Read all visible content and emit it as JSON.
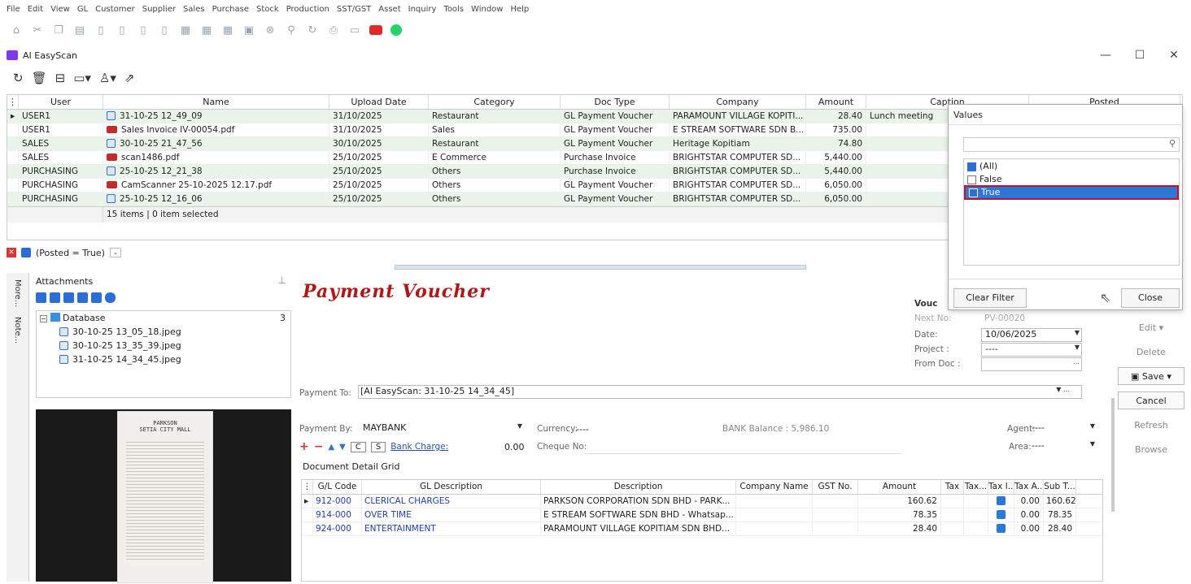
{
  "menu": [
    "File",
    "Edit",
    "View",
    "GL",
    "Customer",
    "Supplier",
    "Sales",
    "Purchase",
    "Stock",
    "Production",
    "SST/GST",
    "Asset",
    "Inquiry",
    "Tools",
    "Window",
    "Help"
  ],
  "window": {
    "title": "AI EasyScan"
  },
  "grid": {
    "columns": [
      "User",
      "Name",
      "Upload Date",
      "Category",
      "Doc Type",
      "Company",
      "Amount",
      "Caption",
      "Posted"
    ],
    "rows": [
      {
        "user": "USER1",
        "name": "31-10-25 12_49_09",
        "date": "31/10/2025",
        "category": "Restaurant",
        "doctype": "GL Payment Voucher",
        "company": "PARAMOUNT VILLAGE KOPITI...",
        "amount": "28.40",
        "caption": "Lunch meeting",
        "icon": "image"
      },
      {
        "user": "USER1",
        "name": "Sales Invoice IV-00054.pdf",
        "date": "31/10/2025",
        "category": "Sales",
        "doctype": "GL Payment Voucher",
        "company": "E STREAM SOFTWARE SDN B...",
        "amount": "735.00",
        "caption": "",
        "icon": "pdf"
      },
      {
        "user": "SALES",
        "name": "30-10-25 21_47_56",
        "date": "30/10/2025",
        "category": "Restaurant",
        "doctype": "GL Payment Voucher",
        "company": "Heritage Kopitiam",
        "amount": "74.80",
        "caption": "",
        "icon": "image"
      },
      {
        "user": "SALES",
        "name": "scan1486.pdf",
        "date": "25/10/2025",
        "category": "E Commerce",
        "doctype": "Purchase Invoice",
        "company": "BRIGHTSTAR COMPUTER SD...",
        "amount": "5,440.00",
        "caption": "",
        "icon": "pdf"
      },
      {
        "user": "PURCHASING",
        "name": "25-10-25 12_21_38",
        "date": "25/10/2025",
        "category": "Others",
        "doctype": "Purchase Invoice",
        "company": "BRIGHTSTAR COMPUTER SD...",
        "amount": "5,440.00",
        "caption": "",
        "icon": "image"
      },
      {
        "user": "PURCHASING",
        "name": "CamScanner 25-10-2025 12.17.pdf",
        "date": "25/10/2025",
        "category": "Others",
        "doctype": "GL Payment Voucher",
        "company": "BRIGHTSTAR COMPUTER SD...",
        "amount": "6,050.00",
        "caption": "",
        "icon": "pdf"
      },
      {
        "user": "PURCHASING",
        "name": "25-10-25 12_16_06",
        "date": "25/10/2025",
        "category": "Others",
        "doctype": "GL Payment Voucher",
        "company": "BRIGHTSTAR COMPUTER SD...",
        "amount": "6,050.00",
        "caption": "",
        "icon": "image"
      }
    ],
    "footer": "15 items | 0 item selected"
  },
  "filter": {
    "text": "(Posted = True)"
  },
  "sidetabs": {
    "more": "More...",
    "note": "Note..."
  },
  "attachments": {
    "title": "Attachments",
    "root": "Database",
    "count": "3",
    "files": [
      "30-10-25 13_05_18.jpeg",
      "30-10-25 13_35_39.jpeg",
      "31-10-25 14_34_45.jpeg"
    ],
    "receipt": {
      "store": "PARKSON",
      "mall": "SETIA CITY MALL"
    }
  },
  "voucher": {
    "title": "Payment Voucher",
    "voucher_label": "Vouc",
    "next_no_label": "Next No:",
    "next_no": "PV-00020",
    "date_label": "Date:",
    "date": "10/06/2025",
    "project_label": "Project :",
    "project": "----",
    "fromdoc_label": "From Doc :",
    "payto_label": "Payment To:",
    "payto": "[AI EasyScan: 31-10-25 14_34_45]",
    "payby_label": "Payment By:",
    "payby": "MAYBANK",
    "currency_label": "Currency:",
    "currency": "----",
    "bank_balance": "BANK Balance : 5,986.10",
    "agent_label": "Agent:",
    "agent": "----",
    "area_label": "Area:",
    "area": "----",
    "c_btn": "C",
    "s_btn": "S",
    "bank_charge_label": "Bank Charge:",
    "bank_charge": "0.00",
    "cheque_label": "Cheque No:",
    "detail_tab": "Document Detail Grid"
  },
  "detail": {
    "columns": [
      "G/L Code",
      "GL Description",
      "Description",
      "Company Name",
      "GST No.",
      "Amount",
      "Tax",
      "Tax...",
      "Tax I...",
      "Tax A...",
      "Sub T..."
    ],
    "rows": [
      {
        "code": "912-000",
        "gl": "CLERICAL CHARGES",
        "desc": "PARKSON CORPORATION SDN BHD - PARK...",
        "amount": "160.62",
        "taxa": "0.00",
        "sub": "160.62"
      },
      {
        "code": "914-000",
        "gl": "OVER TIME",
        "desc": "E STREAM SOFTWARE SDN BHD - Whatsap...",
        "amount": "78.35",
        "taxa": "0.00",
        "sub": "78.35"
      },
      {
        "code": "924-000",
        "gl": "ENTERTAINMENT",
        "desc": "PARAMOUNT VILLAGE KOPITIAM SDN BHD...",
        "amount": "28.40",
        "taxa": "0.00",
        "sub": "28.40"
      }
    ]
  },
  "buttons": {
    "edit": "Edit",
    "delete": "Delete",
    "save": "Save",
    "cancel": "Cancel",
    "refresh": "Refresh",
    "browse": "Browse"
  },
  "popup": {
    "tab": "Values",
    "items": [
      "(All)",
      "False",
      "True"
    ],
    "clear": "Clear Filter",
    "close": "Close"
  }
}
